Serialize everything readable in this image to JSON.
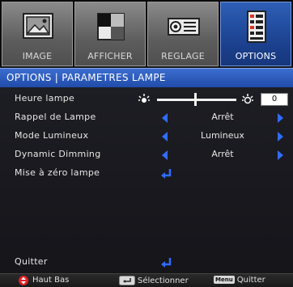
{
  "tabs": [
    {
      "label": "IMAGE",
      "icon": "image-icon",
      "active": false
    },
    {
      "label": "AFFICHER",
      "icon": "display-icon",
      "active": false
    },
    {
      "label": "REGLAGE",
      "icon": "projector-icon",
      "active": false
    },
    {
      "label": "OPTIONS",
      "icon": "options-icon",
      "active": true
    }
  ],
  "header": {
    "title": "OPTIONS | PARAMETRES LAMPE"
  },
  "rows": {
    "lamp_hours": {
      "label": "Heure lampe",
      "value": "0"
    },
    "lamp_reminder": {
      "label": "Rappel de Lampe",
      "value": "Arrêt"
    },
    "brightness_mode": {
      "label": "Mode Lumineux",
      "value": "Lumineux"
    },
    "dynamic_dimming": {
      "label": "Dynamic Dimming",
      "value": "Arrêt"
    },
    "lamp_reset": {
      "label": "Mise à zéro lampe"
    },
    "exit": {
      "label": "Quitter"
    }
  },
  "footer": {
    "navigate": "Haut Bas",
    "select": "Sélectionner",
    "menu_key": "Menu",
    "exit": "Quitter"
  },
  "colors": {
    "accent": "#2f6cff",
    "header": "#2a58bf",
    "active_tab": "#1f4aa8",
    "reset_key": "#e0202a"
  }
}
